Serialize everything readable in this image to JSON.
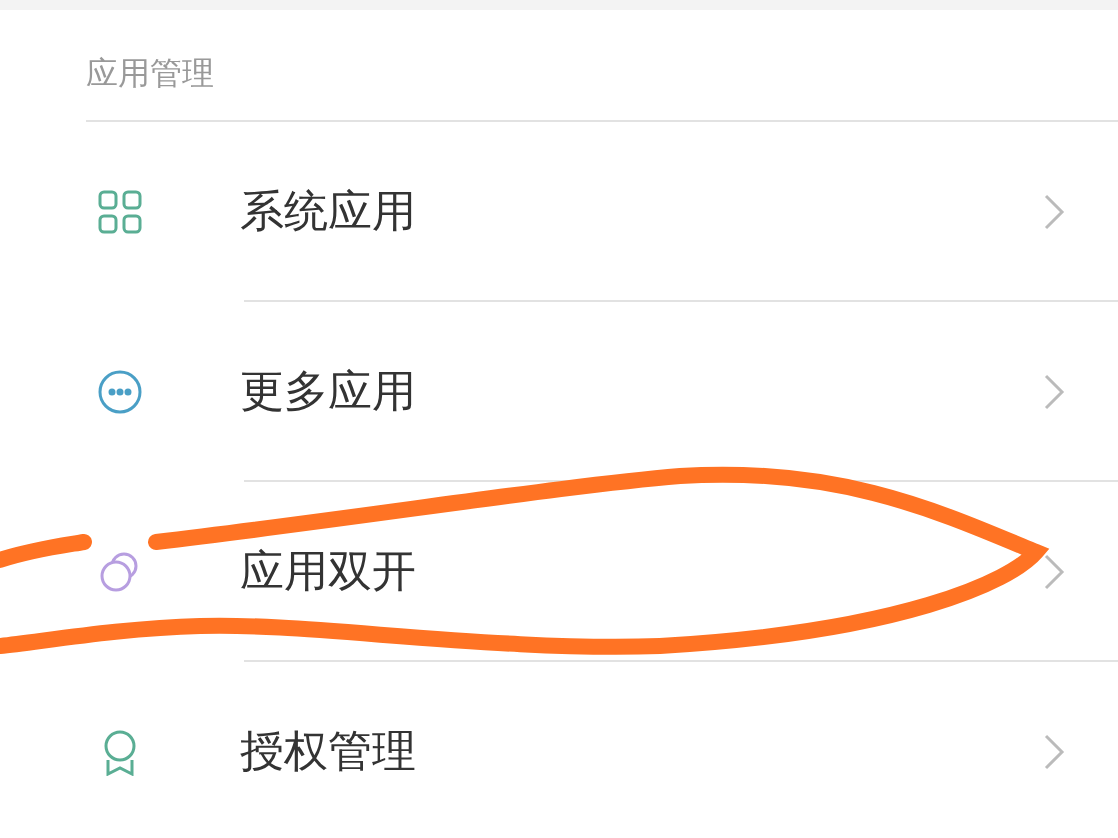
{
  "section": {
    "title": "应用管理"
  },
  "items": [
    {
      "label": "系统应用",
      "kind": "grid",
      "color": "#5aae94",
      "circled": false
    },
    {
      "label": "更多应用",
      "kind": "dots",
      "color": "#4a9fc6",
      "circled": false
    },
    {
      "label": "应用双开",
      "kind": "circles",
      "color": "#b79ee0",
      "circled": true
    },
    {
      "label": "授权管理",
      "kind": "ribbon",
      "color": "#5aae94",
      "circled": false
    }
  ]
}
